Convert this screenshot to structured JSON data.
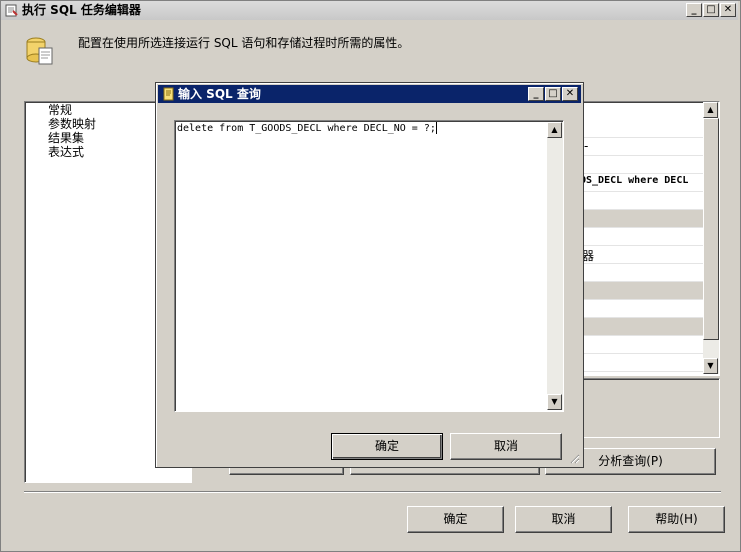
{
  "outer_window": {
    "title": "执行 SQL 任务编辑器",
    "description": "配置在使用所选连接运行 SQL 语句和存储过程时所需的属性。",
    "nav_items": [
      "常规",
      "参数映射",
      "结果集",
      "表达式"
    ],
    "grid_fragments": {
      "row2": "-",
      "row4": "OS_DECL where DECL",
      "row8": "器"
    },
    "parse_query_label": "分析查询(P)",
    "ok_label": "确定",
    "cancel_label": "取消",
    "help_label": "帮助(H)"
  },
  "modal": {
    "title": "输入 SQL 查询",
    "sql_text": "delete from T_GOODS_DECL where DECL_NO = ?;",
    "ok_label": "确定",
    "cancel_label": "取消"
  },
  "icons": {
    "window_icon": "sql-task-icon",
    "description_icon": "database-script-icon",
    "modal_icon": "query-document-icon"
  },
  "colors": {
    "modal_title_bg": "#0a246a",
    "face": "#d4d0c8"
  }
}
